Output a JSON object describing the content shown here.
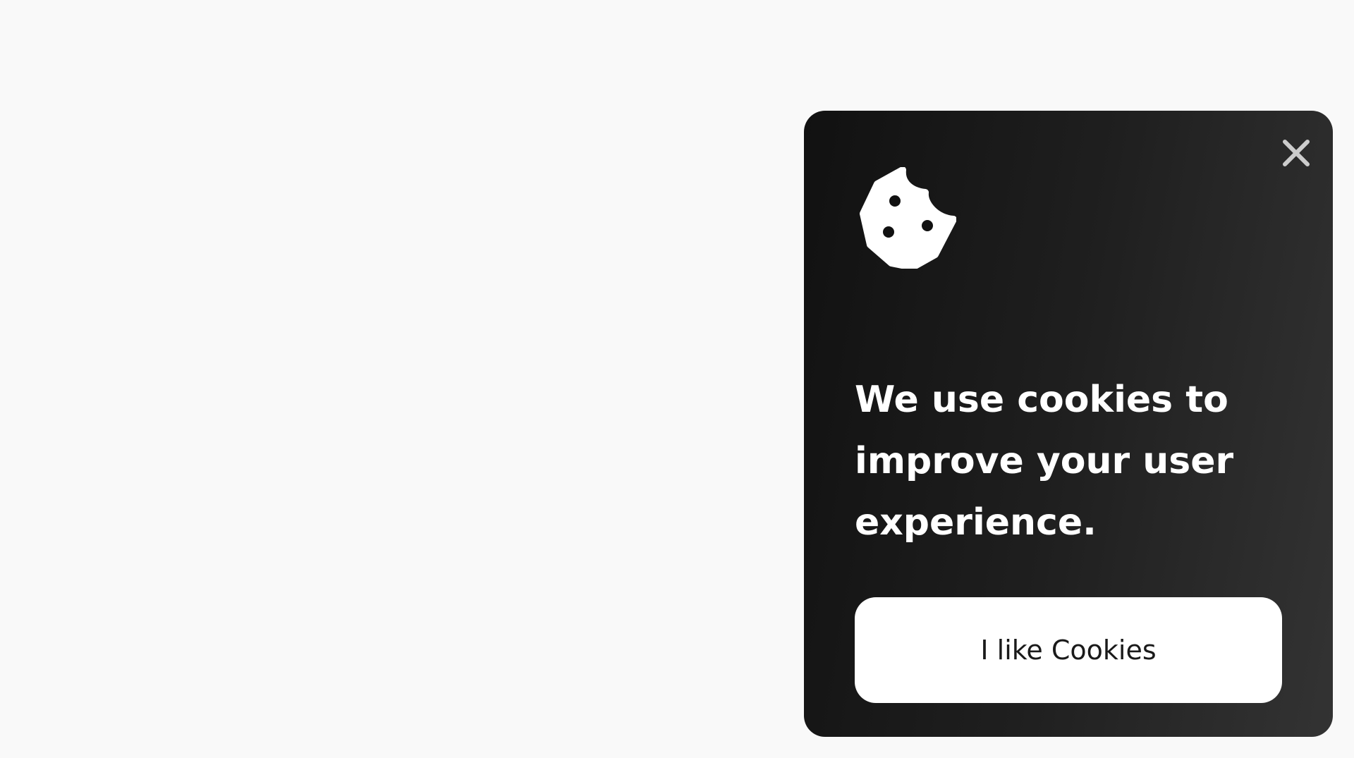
{
  "banner": {
    "close_icon": "close-icon",
    "cookie_icon": "cookie-icon",
    "message": "We use cookies to improve your user experience.",
    "accept_label": "I like Cookies"
  },
  "colors": {
    "page_background": "#f9f9f9",
    "card_gradient_start": "#111111",
    "card_gradient_end": "#333333",
    "text": "#ffffff",
    "button_background": "#ffffff",
    "button_text": "#1a1a1a",
    "close_icon": "#cccccc"
  }
}
